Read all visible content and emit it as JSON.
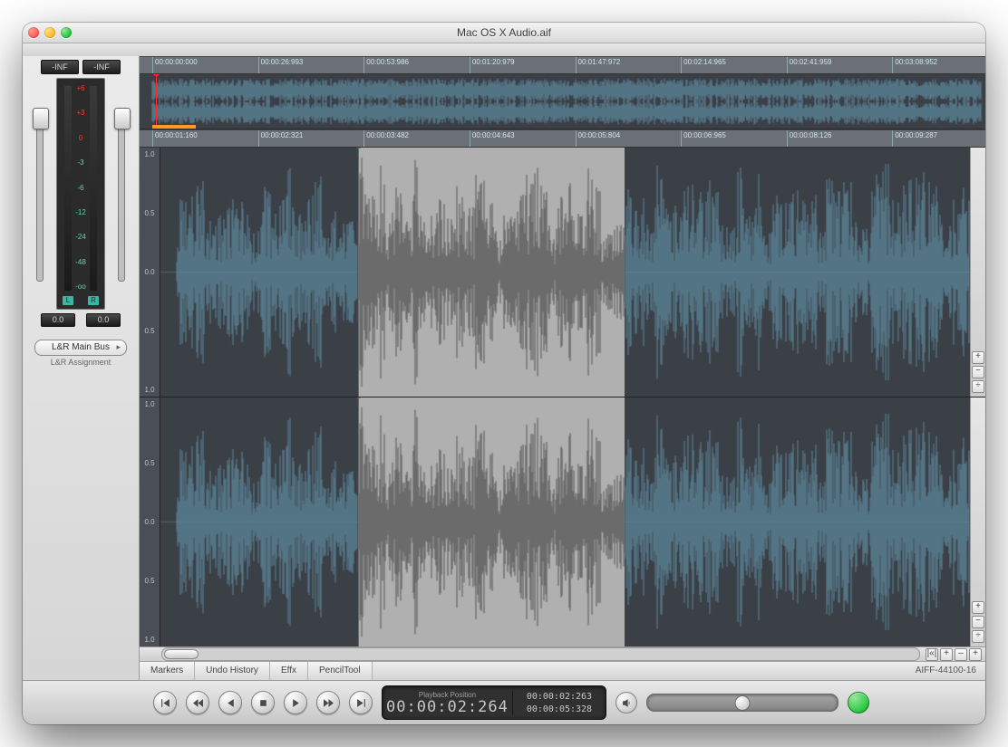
{
  "window": {
    "title": "Mac OS X Audio.aif"
  },
  "meters": {
    "left_peak": "-INF",
    "right_peak": "-INF",
    "scale": [
      "+6",
      "+3",
      "0",
      "-3",
      "-6",
      "-12",
      "-24",
      "-48",
      "-oo"
    ],
    "L": "L",
    "R": "R",
    "left_trim": "0.0",
    "right_trim": "0.0"
  },
  "bus": {
    "button": "L&R Main Bus",
    "caption": "L&R Assignment"
  },
  "overview_ruler": [
    "00:00:00:000",
    "00:00:26:993",
    "00:00:53:986",
    "00:01:20:979",
    "00:01:47:972",
    "00:02:14:965",
    "00:02:41:959",
    "00:03:08:952"
  ],
  "main_ruler": [
    "00:00:01:160",
    "00:00:02:321",
    "00:00:03:482",
    "00:00:04:643",
    "00:00:05:804",
    "00:00:06:965",
    "00:00:08:126",
    "00:00:09:287"
  ],
  "amp_scale": [
    "1.0",
    "0.5",
    "0.0",
    "0.5",
    "1.0"
  ],
  "tabs": [
    "Markers",
    "Undo History",
    "Effx",
    "PencilTool"
  ],
  "format": "AIFF-44100-16",
  "gutter": {
    "plus": "+",
    "minus": "−",
    "fit": "÷"
  },
  "zoom": {
    "reset": "|«|",
    "plus": "+",
    "minus": "–",
    "fit": "+"
  },
  "transport": {
    "label": "Playback Position",
    "position": "00:00:02:264",
    "sel_start": "00:00:02:263",
    "sel_end": "00:00:05:328"
  },
  "icons": {
    "play": "play-icon",
    "stop": "stop-icon",
    "rec": "record-icon",
    "ff": "ff-icon",
    "rw": "rw-icon",
    "end": "end-icon",
    "begin": "begin-icon",
    "loop": "loop-icon",
    "speaker": "speaker-icon"
  }
}
